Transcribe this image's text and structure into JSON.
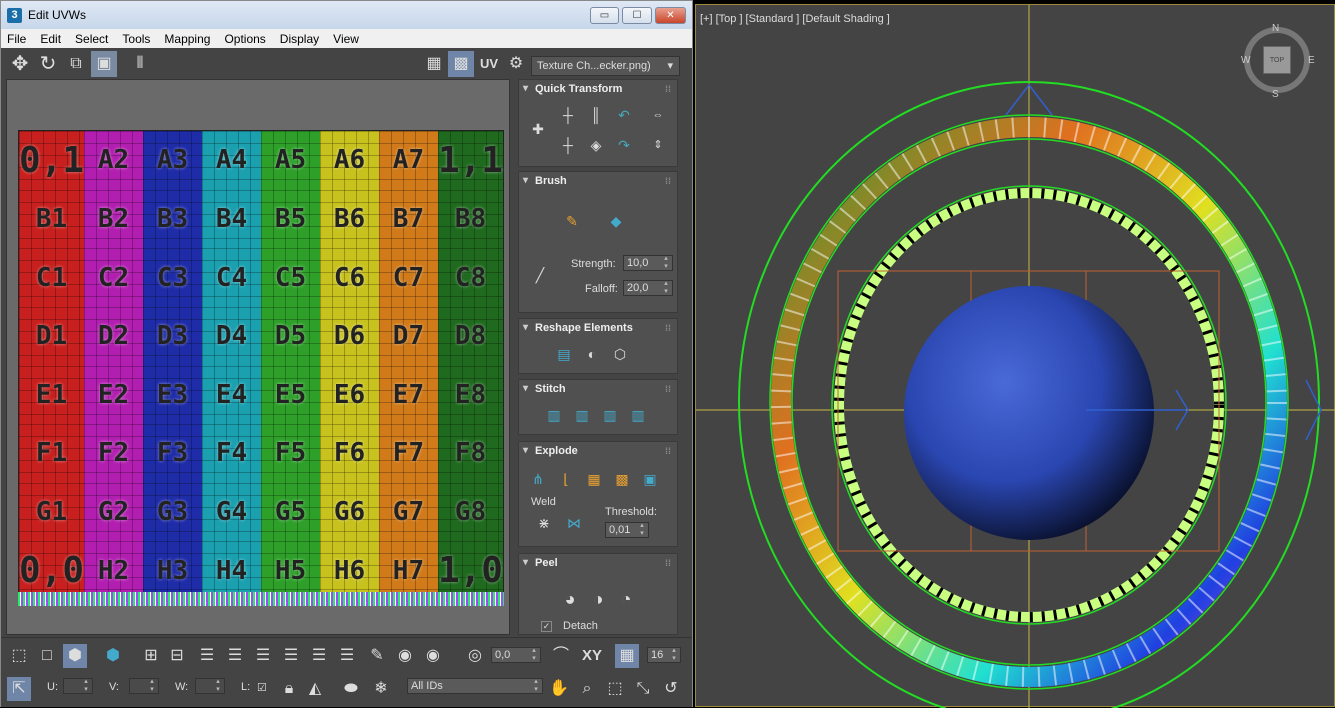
{
  "window": {
    "title": "Edit UVWs",
    "icon_label": "3",
    "buttons": {
      "minimize": "▭",
      "maximize": "☐",
      "close": "✕"
    }
  },
  "menu": [
    "File",
    "Edit",
    "Select",
    "Tools",
    "Mapping",
    "Options",
    "Display",
    "View"
  ],
  "toolbar": {
    "uv_label": "UV",
    "texture_dropdown": "Texture Ch...ecker.png)"
  },
  "checker": {
    "rows": [
      [
        "0,1",
        "A2",
        "A3",
        "A4",
        "A5",
        "A6",
        "A7",
        "1,1"
      ],
      [
        "B1",
        "B2",
        "B3",
        "B4",
        "B5",
        "B6",
        "B7",
        "B8"
      ],
      [
        "C1",
        "C2",
        "C3",
        "C4",
        "C5",
        "C6",
        "C7",
        "C8"
      ],
      [
        "D1",
        "D2",
        "D3",
        "D4",
        "D5",
        "D6",
        "D7",
        "D8"
      ],
      [
        "E1",
        "E2",
        "E3",
        "E4",
        "E5",
        "E6",
        "E7",
        "E8"
      ],
      [
        "F1",
        "F2",
        "F3",
        "F4",
        "F5",
        "F6",
        "F7",
        "F8"
      ],
      [
        "G1",
        "G2",
        "G3",
        "G4",
        "G5",
        "G6",
        "G7",
        "G8"
      ],
      [
        "0,0",
        "H2",
        "H3",
        "H4",
        "H5",
        "H6",
        "H7",
        "1,0"
      ]
    ],
    "column_colors": [
      "#c8201e",
      "#b21fb0",
      "#1f2ca8",
      "#1ba0b0",
      "#2ea02a",
      "#c8c21e",
      "#d07a1a",
      "#1f6a1f"
    ]
  },
  "panel": {
    "quick_transform": {
      "title": "Quick Transform"
    },
    "brush": {
      "title": "Brush",
      "strength_label": "Strength:",
      "strength_value": "10,0",
      "falloff_label": "Falloff:",
      "falloff_value": "20,0"
    },
    "reshape": {
      "title": "Reshape Elements"
    },
    "stitch": {
      "title": "Stitch"
    },
    "explode": {
      "title": "Explode",
      "weld_label": "Weld",
      "threshold_label": "Threshold:",
      "threshold_value": "0,01"
    },
    "peel": {
      "title": "Peel",
      "detach_label": "Detach",
      "detach_checked": true
    }
  },
  "bottom": {
    "rotate_value": "0,0",
    "xy_label": "XY",
    "grid_value": "16",
    "u_label": "U:",
    "v_label": "V:",
    "w_label": "W:",
    "l_label": "L:",
    "ids_dropdown": "All IDs"
  },
  "viewport": {
    "label": "[+] [Top ] [Standard ] [Default Shading ]",
    "compass": {
      "n": "N",
      "s": "S",
      "w": "W",
      "e": "E",
      "top": "TOP"
    }
  }
}
